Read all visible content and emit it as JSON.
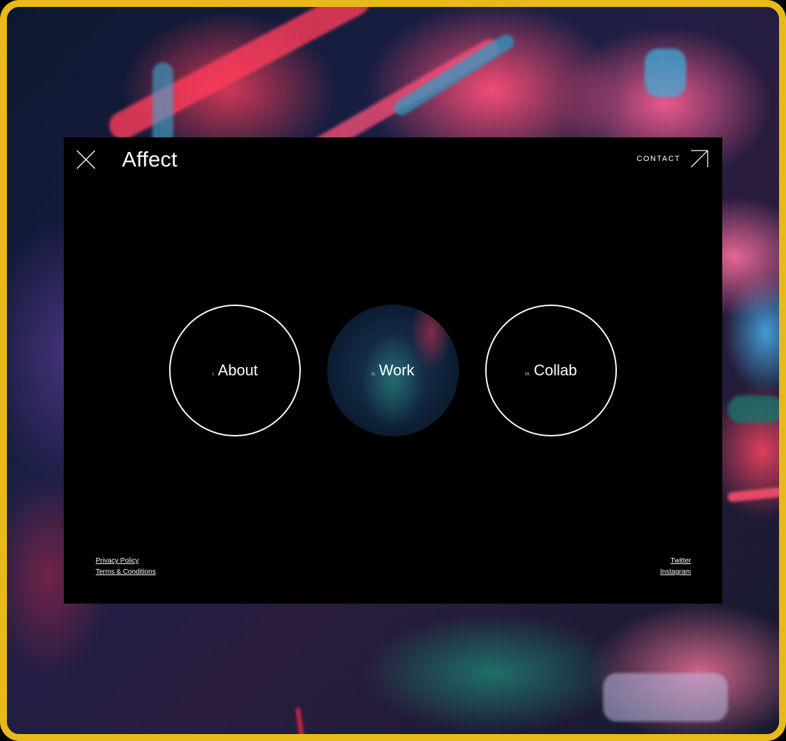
{
  "brand": {
    "name": "Affect"
  },
  "header": {
    "close_icon": "close-icon",
    "contact_label": "CONTACT",
    "contact_icon": "arrow-up-right-icon"
  },
  "nav": {
    "items": [
      {
        "numeral": "I.",
        "label": "About",
        "style": "outline"
      },
      {
        "numeral": "II.",
        "label": "Work",
        "style": "image"
      },
      {
        "numeral": "III.",
        "label": "Collab",
        "style": "outline"
      }
    ]
  },
  "footer": {
    "left_links": [
      "Privacy Policy",
      "Terms & Conditions"
    ],
    "right_links": [
      "Twitter",
      "Instagram"
    ]
  },
  "colors": {
    "frame_border": "#e8b91a",
    "window_bg": "#000000",
    "text": "#ffffff"
  }
}
